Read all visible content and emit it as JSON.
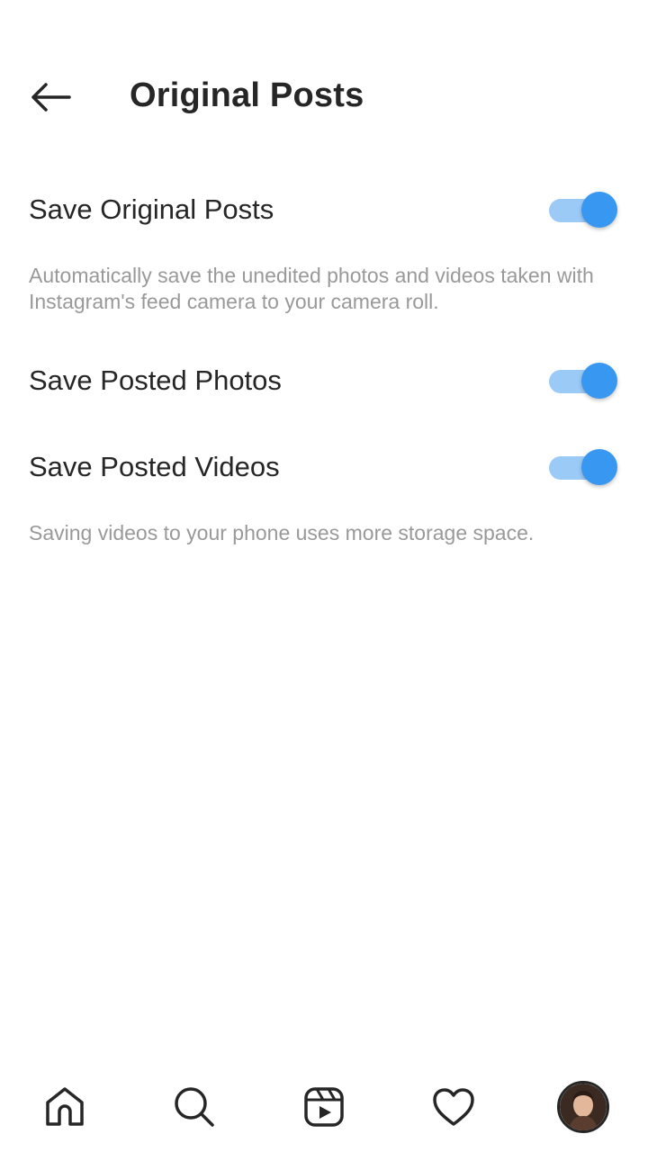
{
  "header": {
    "title": "Original Posts",
    "back_icon": "arrow-left-icon"
  },
  "settings": [
    {
      "label": "Save Original Posts",
      "enabled": true,
      "description": "Automatically save the unedited photos and videos taken with Instagram's feed camera to your camera roll."
    },
    {
      "label": "Save Posted Photos",
      "enabled": true
    },
    {
      "label": "Save Posted Videos",
      "enabled": true,
      "description": "Saving videos to your phone uses more storage space."
    }
  ],
  "colors": {
    "toggle_thumb": "#3897f0",
    "toggle_track": "#9ccaf7",
    "text_primary": "#262626",
    "text_secondary": "#999999"
  },
  "bottom_nav": {
    "items": [
      "home-icon",
      "search-icon",
      "reels-icon",
      "heart-icon",
      "profile-avatar"
    ]
  }
}
